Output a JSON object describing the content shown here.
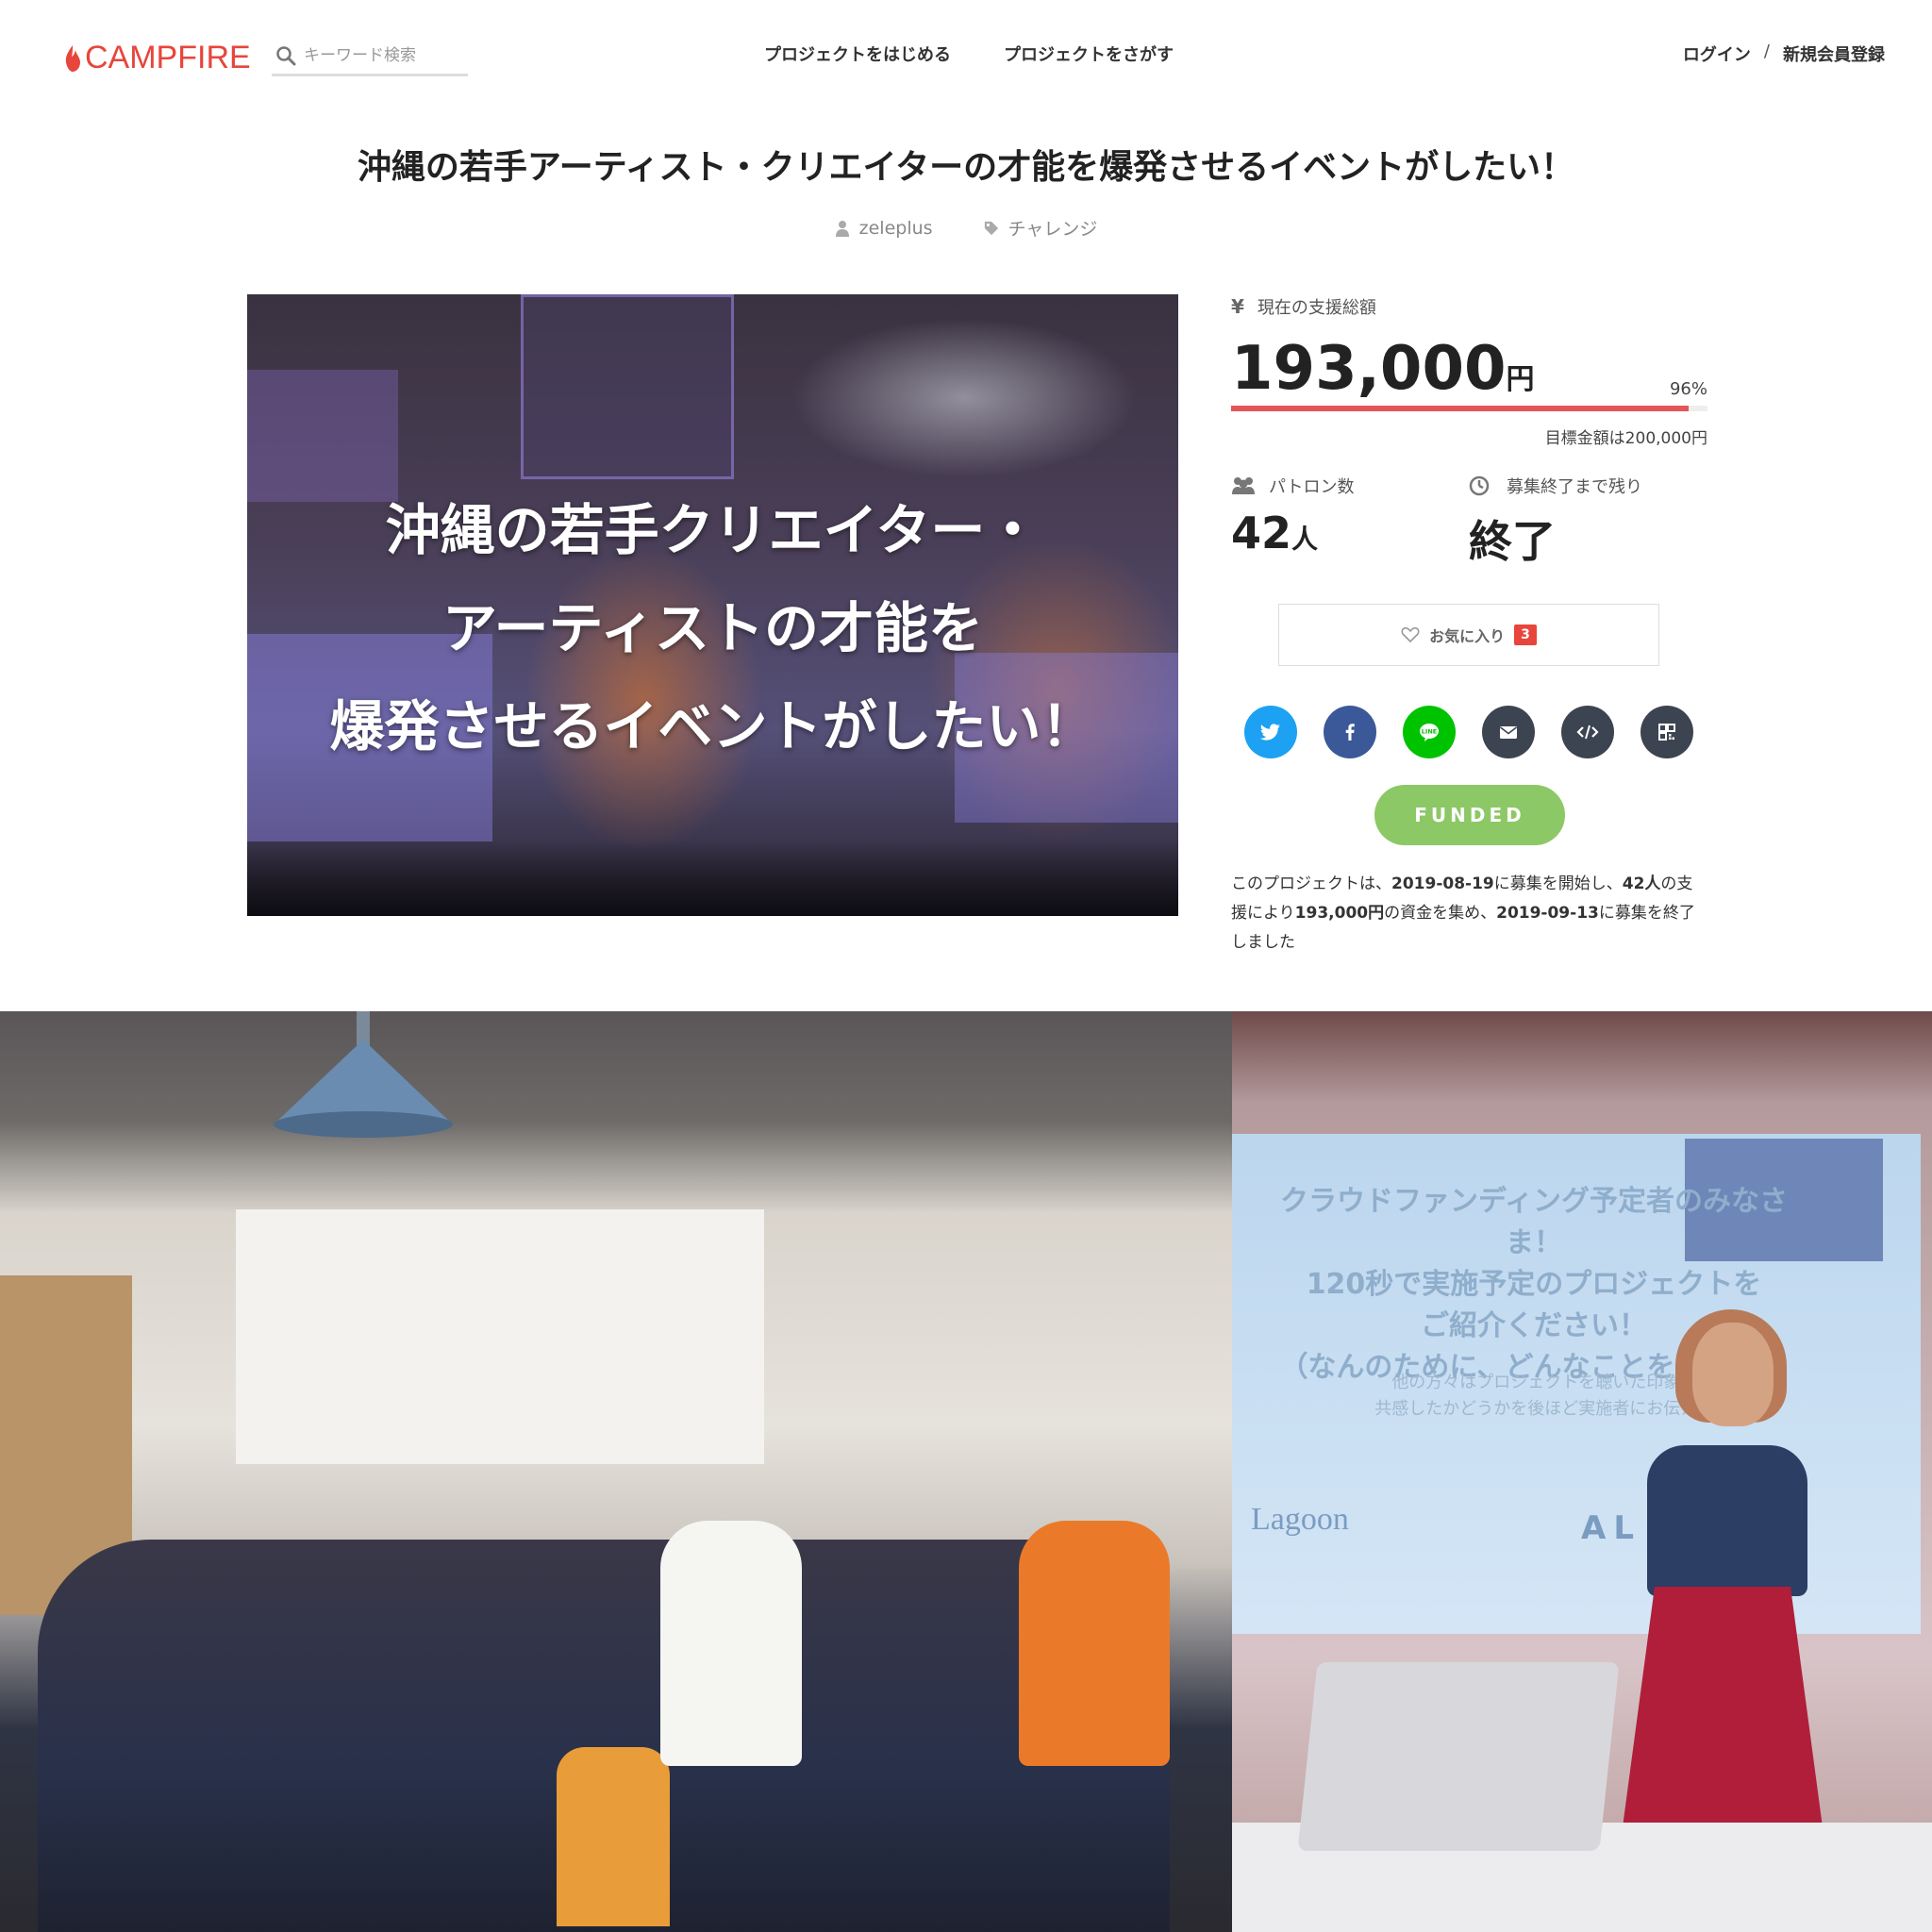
{
  "header": {
    "logo_text": "CAMPFIRE",
    "search_placeholder": "キーワード検索",
    "nav": [
      "プロジェクトをはじめる",
      "プロジェクトをさがす"
    ],
    "login": "ログイン",
    "separator": "/",
    "signup": "新規会員登録",
    "brand_color": "#e8453c"
  },
  "project": {
    "title": "沖縄の若手アーティスト・クリエイターの才能を爆発させるイベントがしたい！",
    "owner": "zeleplus",
    "category": "チャレンジ",
    "hero_text": [
      "沖縄の若手クリエイター・",
      "アーティストの才能を",
      "爆発させるイベントがしたい！"
    ]
  },
  "funding": {
    "label": "現在の支援総額",
    "amount": "193,000",
    "unit": "円",
    "percent": "96%",
    "progress_fraction": 0.96,
    "goal": "目標金額は200,000円",
    "patrons_label": "パトロン数",
    "patrons_value": "42",
    "patrons_unit": "人",
    "remaining_label": "募集終了まで残り",
    "remaining_value": "終了",
    "favorite_label": "お気に入り",
    "favorite_count": "3",
    "funded_label": "FUNDED",
    "summary": {
      "p1": "このプロジェクトは、",
      "start": "2019-08-19",
      "p2": "に募集を開始し、",
      "patrons": "42人",
      "p3": "の支援により",
      "amount": "193,000円",
      "p4": "の資金を集め、",
      "end": "2019-09-13",
      "p5": "に募集を終了しました"
    }
  },
  "share": [
    {
      "name": "twitter",
      "color": "#1da1f2"
    },
    {
      "name": "facebook",
      "color": "#3b5998"
    },
    {
      "name": "line",
      "color": "#00c300"
    },
    {
      "name": "mail",
      "color": "#3d4451"
    },
    {
      "name": "embed",
      "color": "#3d4451"
    },
    {
      "name": "qr",
      "color": "#3d4451"
    }
  ],
  "photos": {
    "projector_text": [
      "クラウドファンディング予定者のみなさま！",
      "120秒で実施予定のプロジェクトを",
      "ご紹介ください！",
      "（なんのために、どんなことを、いつや"
    ],
    "projector_sub": [
      "他の方々はプロジェクトを聴いた印象や、",
      "共感したかどうかを後ほど実施者にお伝えくだ"
    ],
    "projector_logo": "Lagoon",
    "projector_logo2": "AL"
  }
}
